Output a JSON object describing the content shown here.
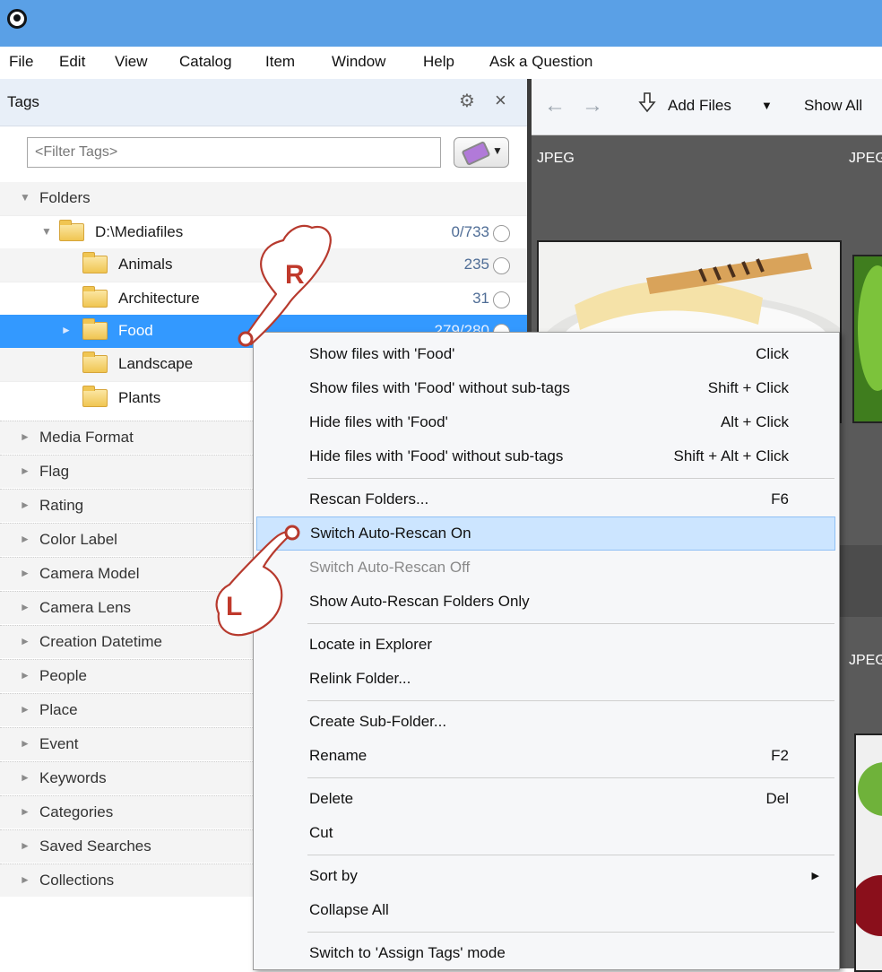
{
  "menubar": {
    "items": [
      "File",
      "Edit",
      "View",
      "Catalog",
      "Item",
      "Window",
      "Help",
      "Ask a Question"
    ]
  },
  "tags_panel": {
    "title": "Tags",
    "filter_placeholder": "<Filter Tags>",
    "folders_label": "Folders",
    "root": {
      "label": "D:\\Mediafiles",
      "count": "0/733"
    },
    "subfolders": [
      {
        "label": "Animals",
        "count": "235"
      },
      {
        "label": "Architecture",
        "count": "31"
      },
      {
        "label": "Food",
        "count": "279/280",
        "selected": true
      },
      {
        "label": "Landscape"
      },
      {
        "label": "Plants"
      }
    ],
    "categories": [
      "Media Format",
      "Flag",
      "Rating",
      "Color Label",
      "Camera Model",
      "Camera Lens",
      "Creation Datetime",
      "People",
      "Place",
      "Event",
      "Keywords",
      "Categories",
      "Saved Searches",
      "Collections"
    ]
  },
  "viewer": {
    "add_files_label": "Add Files",
    "show_all_label": "Show All",
    "thumb_labels": [
      "JPEG",
      "JPEG",
      "JPEG"
    ]
  },
  "context_menu": {
    "items": [
      {
        "label": "Show files with 'Food'",
        "shortcut": "Click"
      },
      {
        "label": "Show files with 'Food' without sub-tags",
        "shortcut": "Shift + Click"
      },
      {
        "label": "Hide files with 'Food'",
        "shortcut": "Alt + Click"
      },
      {
        "label": "Hide files with 'Food' without sub-tags",
        "shortcut": "Shift + Alt + Click"
      },
      {
        "label": "Rescan Folders...",
        "shortcut": "F6"
      },
      {
        "label": "Switch Auto-Rescan On",
        "highlighted": true
      },
      {
        "label": "Switch Auto-Rescan Off",
        "disabled": true
      },
      {
        "label": "Show Auto-Rescan Folders Only"
      },
      {
        "label": "Locate in Explorer"
      },
      {
        "label": "Relink Folder..."
      },
      {
        "label": "Create Sub-Folder..."
      },
      {
        "label": "Rename",
        "shortcut": "F2"
      },
      {
        "label": "Delete",
        "shortcut": "Del"
      },
      {
        "label": "Cut"
      },
      {
        "label": "Sort by",
        "submenu": true
      },
      {
        "label": "Collapse All"
      },
      {
        "label": "Switch to 'Assign Tags' mode"
      }
    ]
  },
  "annotations": {
    "right_click_letter": "R",
    "left_click_letter": "L"
  },
  "colors": {
    "titlebar": "#5aa0e6",
    "selection": "#3399ff",
    "menu_highlight": "#cce5ff",
    "count_text": "#4f6d96"
  }
}
